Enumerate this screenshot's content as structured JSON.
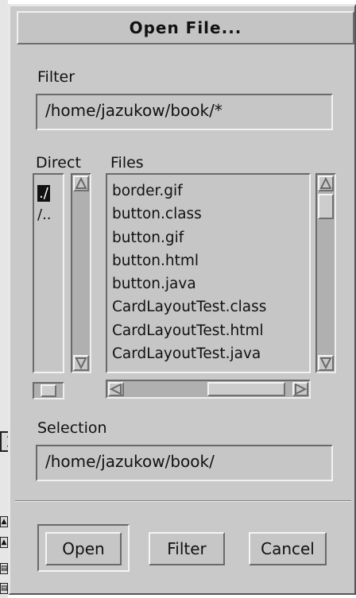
{
  "dialog": {
    "title": "Open File..."
  },
  "filter": {
    "label": "Filter",
    "value": "/home/jazukow/book/*"
  },
  "directories": {
    "label": "Direct",
    "items": [
      "./",
      "/.."
    ]
  },
  "files": {
    "label": "Files",
    "items": [
      "border.gif",
      "button.class",
      "button.gif",
      "button.html",
      "button.java",
      "CardLayoutTest.class",
      "CardLayoutTest.html",
      "CardLayoutTest.java"
    ]
  },
  "selection": {
    "label": "Selection",
    "value": "/home/jazukow/book/"
  },
  "buttons": {
    "open": "Open",
    "filter": "Filter",
    "cancel": "Cancel"
  },
  "left_strip": {
    "close_icon": "close-icon",
    "tool_icons": [
      "select-icon",
      "select-icon",
      "document-icon",
      "document-icon"
    ]
  }
}
